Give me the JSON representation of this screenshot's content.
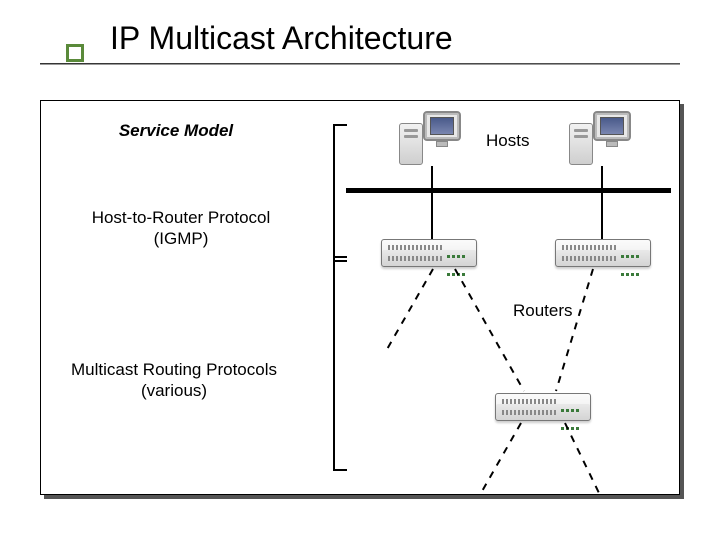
{
  "title": "IP Multicast Architecture",
  "labels": {
    "service_model": "Service Model",
    "igmp_line1": "Host-to-Router Protocol",
    "igmp_line2": "(IGMP)",
    "mrp_line1": "Multicast Routing Protocols",
    "mrp_line2": "(various)",
    "hosts": "Hosts",
    "routers": "Routers"
  }
}
